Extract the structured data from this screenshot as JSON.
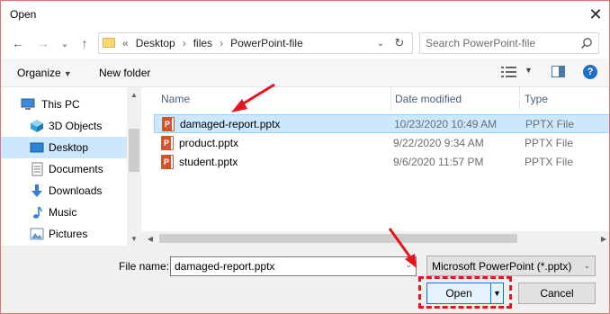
{
  "window": {
    "title": "Open",
    "close_glyph": "✕"
  },
  "nav": {
    "back_glyph": "←",
    "forward_glyph": "→",
    "recent_glyph": "⌄",
    "up_glyph": "↑",
    "breadcrumb": {
      "overflow": "«",
      "items": [
        "Desktop",
        "files",
        "PowerPoint-file"
      ],
      "separator": "›"
    },
    "dropdown_glyph": "⌄",
    "refresh_glyph": "↻"
  },
  "search": {
    "placeholder": "Search PowerPoint-file"
  },
  "toolbar": {
    "organize_label": "Organize",
    "caret": "▼",
    "new_folder_label": "New folder",
    "help_label": "?"
  },
  "sidebar": {
    "items": [
      {
        "label": "This PC",
        "icon": "pc-icon",
        "selected": false
      },
      {
        "label": "3D Objects",
        "icon": "3d-objects-icon",
        "selected": false
      },
      {
        "label": "Desktop",
        "icon": "desktop-icon",
        "selected": true
      },
      {
        "label": "Documents",
        "icon": "documents-icon",
        "selected": false
      },
      {
        "label": "Downloads",
        "icon": "downloads-icon",
        "selected": false
      },
      {
        "label": "Music",
        "icon": "music-icon",
        "selected": false
      },
      {
        "label": "Pictures",
        "icon": "pictures-icon",
        "selected": false
      }
    ],
    "scroll_up": "▲",
    "scroll_down": "▼"
  },
  "files": {
    "columns": [
      "Name",
      "Date modified",
      "Type"
    ],
    "rows": [
      {
        "name": "damaged-report.pptx",
        "date": "10/23/2020 10:49 AM",
        "type": "PPTX File",
        "selected": true
      },
      {
        "name": "product.pptx",
        "date": "9/22/2020 9:34 AM",
        "type": "PPTX File",
        "selected": false
      },
      {
        "name": "student.pptx",
        "date": "9/6/2020 11:57 PM",
        "type": "PPTX File",
        "selected": false
      }
    ],
    "scroll_left": "◀",
    "scroll_right": "▶"
  },
  "footer": {
    "filename_label": "File name:",
    "filename_value": "damaged-report.pptx",
    "filetype_value": "Microsoft PowerPoint (*.pptx)",
    "dropdown_glyph": "⌄",
    "open_label": "Open",
    "open_split_glyph": "▼",
    "cancel_label": "Cancel"
  },
  "colors": {
    "annotation": "#e8141b",
    "selection": "#cce8ff",
    "accent": "#0078d7"
  }
}
